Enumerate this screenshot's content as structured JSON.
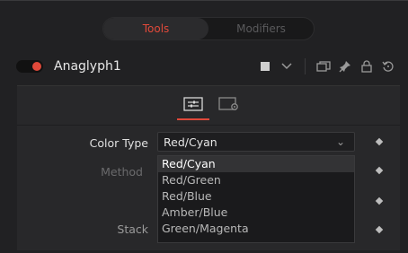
{
  "tabs": [
    {
      "label": "Tools",
      "active": true
    },
    {
      "label": "Modifiers",
      "active": false
    }
  ],
  "node": {
    "name": "Anaglyph1",
    "enabled": true,
    "icons": [
      "color-swatch-icon",
      "chevron-down-icon",
      "versions-icon",
      "pin-icon",
      "lock-icon",
      "reset-icon"
    ]
  },
  "subtabs": [
    {
      "name": "controls-tab",
      "active": true
    },
    {
      "name": "settings-tab",
      "active": false
    }
  ],
  "controls": {
    "color_type_label": "Color Type",
    "color_type_value": "Red/Cyan",
    "method_label": "Method",
    "stack_label": "Stack",
    "options": [
      "Red/Cyan",
      "Red/Green",
      "Red/Blue",
      "Amber/Blue",
      "Green/Magenta"
    ]
  },
  "colors": {
    "accent": "#e0493a",
    "background": "#212123",
    "panel": "#28282a"
  }
}
